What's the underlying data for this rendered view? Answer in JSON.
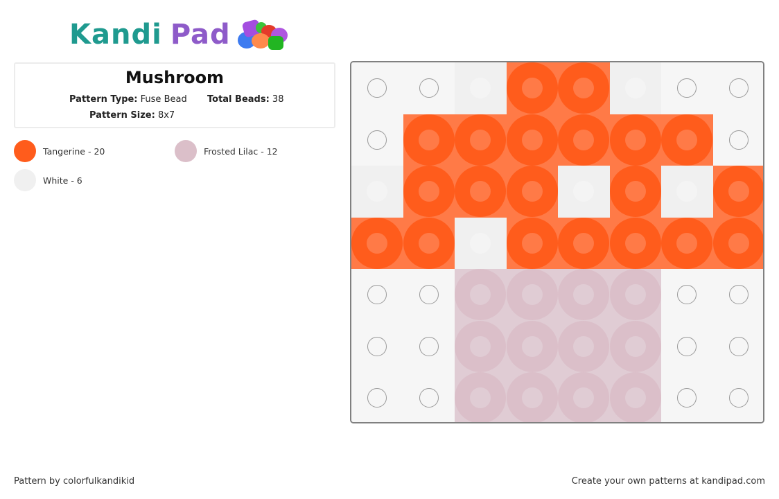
{
  "logo": {
    "word1": "Kandi",
    "word2": "Pad"
  },
  "pattern": {
    "title": "Mushroom",
    "type_label": "Pattern Type:",
    "type_value": "Fuse Bead",
    "total_label": "Total Beads:",
    "total_value": "38",
    "size_label": "Pattern Size:",
    "size_value": "8x7"
  },
  "legend": [
    {
      "key": "T",
      "name": "Tangerine - 20",
      "color": "#ff5c1c",
      "inner": "#ff7a47"
    },
    {
      "key": "L",
      "name": "Frosted Lilac - 12",
      "color": "#dbbfc9",
      "inner": "#e0ccd4"
    },
    {
      "key": "W",
      "name": "White - 6",
      "color": "#f0f0f0",
      "inner": "#f4f4f4"
    }
  ],
  "board": {
    "columns": 8,
    "rows": 7,
    "empty_color": "#f6f6f6",
    "grid": [
      "EEWTTWEE",
      "ETTTTTTE",
      "WTTTWTWT",
      "TTWTTTTT",
      "EELLLLEE",
      "EELLLLEE",
      "EELLLLEE"
    ]
  },
  "footer": {
    "credit": "Pattern by colorfulkandikid",
    "promo": "Create your own patterns at kandipad.com"
  }
}
